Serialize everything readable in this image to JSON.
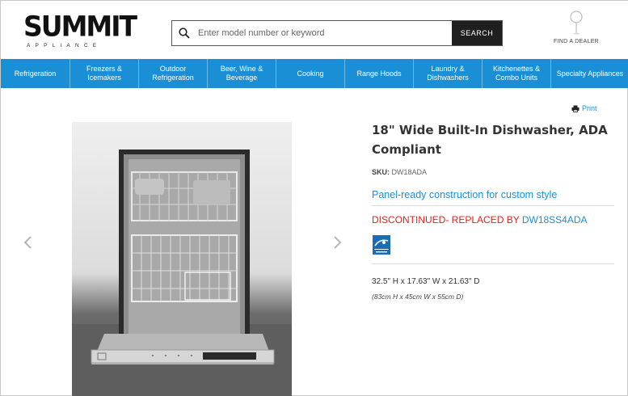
{
  "header": {
    "logo_word": "SUMMIT",
    "logo_sub": "APPLIANCE",
    "search_placeholder": "Enter model number or keyword",
    "search_button": "SEARCH",
    "dealer_label": "FIND A DEALER"
  },
  "nav": {
    "items": [
      {
        "line1": "Refrigeration",
        "line2": ""
      },
      {
        "line1": "Freezers &",
        "line2": "Icemakers"
      },
      {
        "line1": "Outdoor",
        "line2": "Refrigeration"
      },
      {
        "line1": "Beer, Wine &",
        "line2": "Beverage"
      },
      {
        "line1": "Cooking",
        "line2": ""
      },
      {
        "line1": "Range Hoods",
        "line2": ""
      },
      {
        "line1": "Laundry &",
        "line2": "Dishwashers"
      },
      {
        "line1": "Kitchenettes &",
        "line2": "Combo Units"
      },
      {
        "line1": "Specialty Appliances",
        "line2": ""
      }
    ]
  },
  "product": {
    "print_label": "Print",
    "title": "18\" Wide Built-In Dishwasher, ADA Compliant",
    "sku_label": "SKU:",
    "sku_value": "DW18ADA",
    "tagline": "Panel-ready construction for custom style",
    "discontinued_text": "DISCONTINUED- REPLACED BY",
    "replacement_model": "DW18SS4ADA",
    "dimensions": "32.5\" H x 17.63\" W x 21.63\" D",
    "dimensions_metric": "(83cm H x 45cm W x 55cm D)"
  },
  "colors": {
    "nav_blue": "#1a8fd6",
    "discontinued_red": "#e3221b",
    "energy_star_blue": "#1a6db5"
  }
}
